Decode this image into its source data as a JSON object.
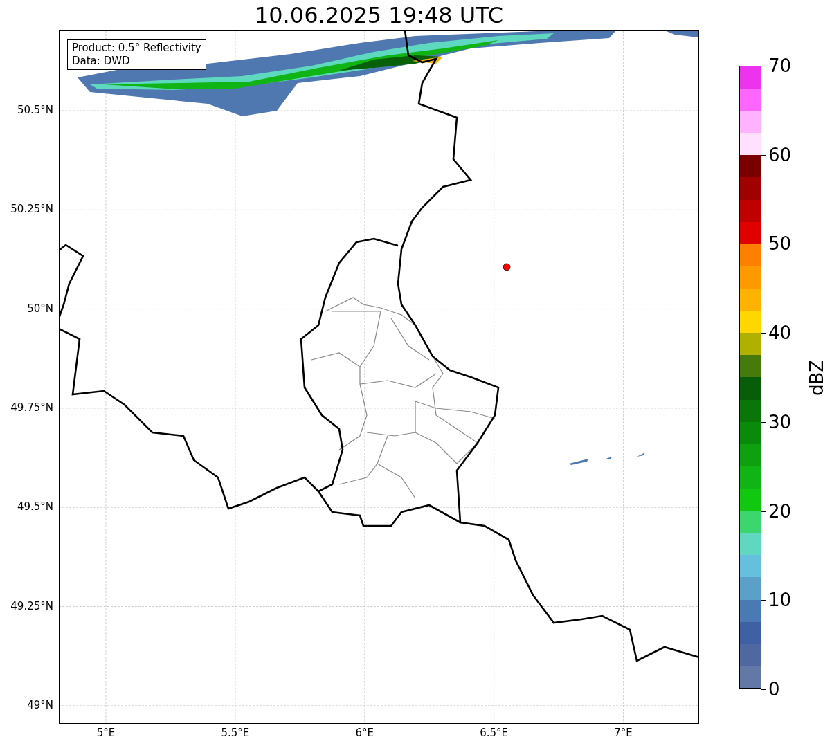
{
  "title": "10.06.2025 19:48 UTC",
  "info_box": [
    "Product: 0.5° Reflectivity",
    "Data: DWD"
  ],
  "lat_labels": [
    "50.5°N",
    "50.25°N",
    "50°N",
    "49.75°N",
    "49.5°N",
    "49.25°N",
    "49°N"
  ],
  "lon_labels": [
    "5°E",
    "5.5°E",
    "6°E",
    "6.5°E",
    "7°E"
  ],
  "colorbar": {
    "label": "dBZ",
    "ticks": [
      "70",
      "60",
      "50",
      "40",
      "30",
      "20",
      "10",
      "0"
    ],
    "bins": [
      {
        "color": "#6478a8"
      },
      {
        "color": "#5068a0"
      },
      {
        "color": "#4060a4"
      },
      {
        "color": "#4a7ab4"
      },
      {
        "color": "#5aa0c8"
      },
      {
        "color": "#64c0dc"
      },
      {
        "color": "#60d8c0"
      },
      {
        "color": "#3cd66e"
      },
      {
        "color": "#10c810"
      },
      {
        "color": "#10b414"
      },
      {
        "color": "#0ea00e"
      },
      {
        "color": "#0a8a0a"
      },
      {
        "color": "#0a760a"
      },
      {
        "color": "#085e08"
      },
      {
        "color": "#467a0a"
      },
      {
        "color": "#b0b000"
      },
      {
        "color": "#ffd700"
      },
      {
        "color": "#ffb300"
      },
      {
        "color": "#ff9900"
      },
      {
        "color": "#ff7f00"
      },
      {
        "color": "#e00000"
      },
      {
        "color": "#c00000"
      },
      {
        "color": "#a00000"
      },
      {
        "color": "#7a0000"
      },
      {
        "color": "#ffe0ff"
      },
      {
        "color": "#ffb3ff"
      },
      {
        "color": "#ff66ff"
      },
      {
        "color": "#ee33ee"
      }
    ]
  }
}
